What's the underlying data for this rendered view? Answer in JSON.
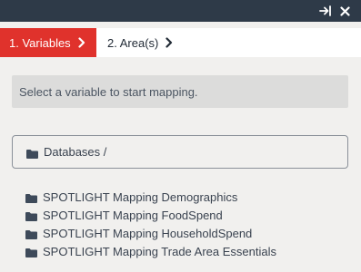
{
  "window_controls": {
    "expand_icon": "arrow-right-to-bar-icon",
    "close_icon": "close-icon"
  },
  "tabs": [
    {
      "label": "1. Variables",
      "active": true
    },
    {
      "label": "2. Area(s)",
      "active": false
    }
  ],
  "info_message": "Select a variable to start mapping.",
  "breadcrumb": {
    "label": "Databases /",
    "icon": "folder-icon"
  },
  "databases": [
    {
      "label": "SPOTLIGHT Mapping Demographics",
      "icon": "folder-icon"
    },
    {
      "label": "SPOTLIGHT Mapping FoodSpend",
      "icon": "folder-icon"
    },
    {
      "label": "SPOTLIGHT Mapping HouseholdSpend",
      "icon": "folder-icon"
    },
    {
      "label": "SPOTLIGHT Mapping Trade Area Essentials",
      "icon": "folder-icon"
    }
  ],
  "colors": {
    "topbar": "#2e3a48",
    "accent": "#e0322c",
    "background": "#f1f0ee",
    "info_background": "#dcdcdb",
    "text": "#3a4350"
  }
}
